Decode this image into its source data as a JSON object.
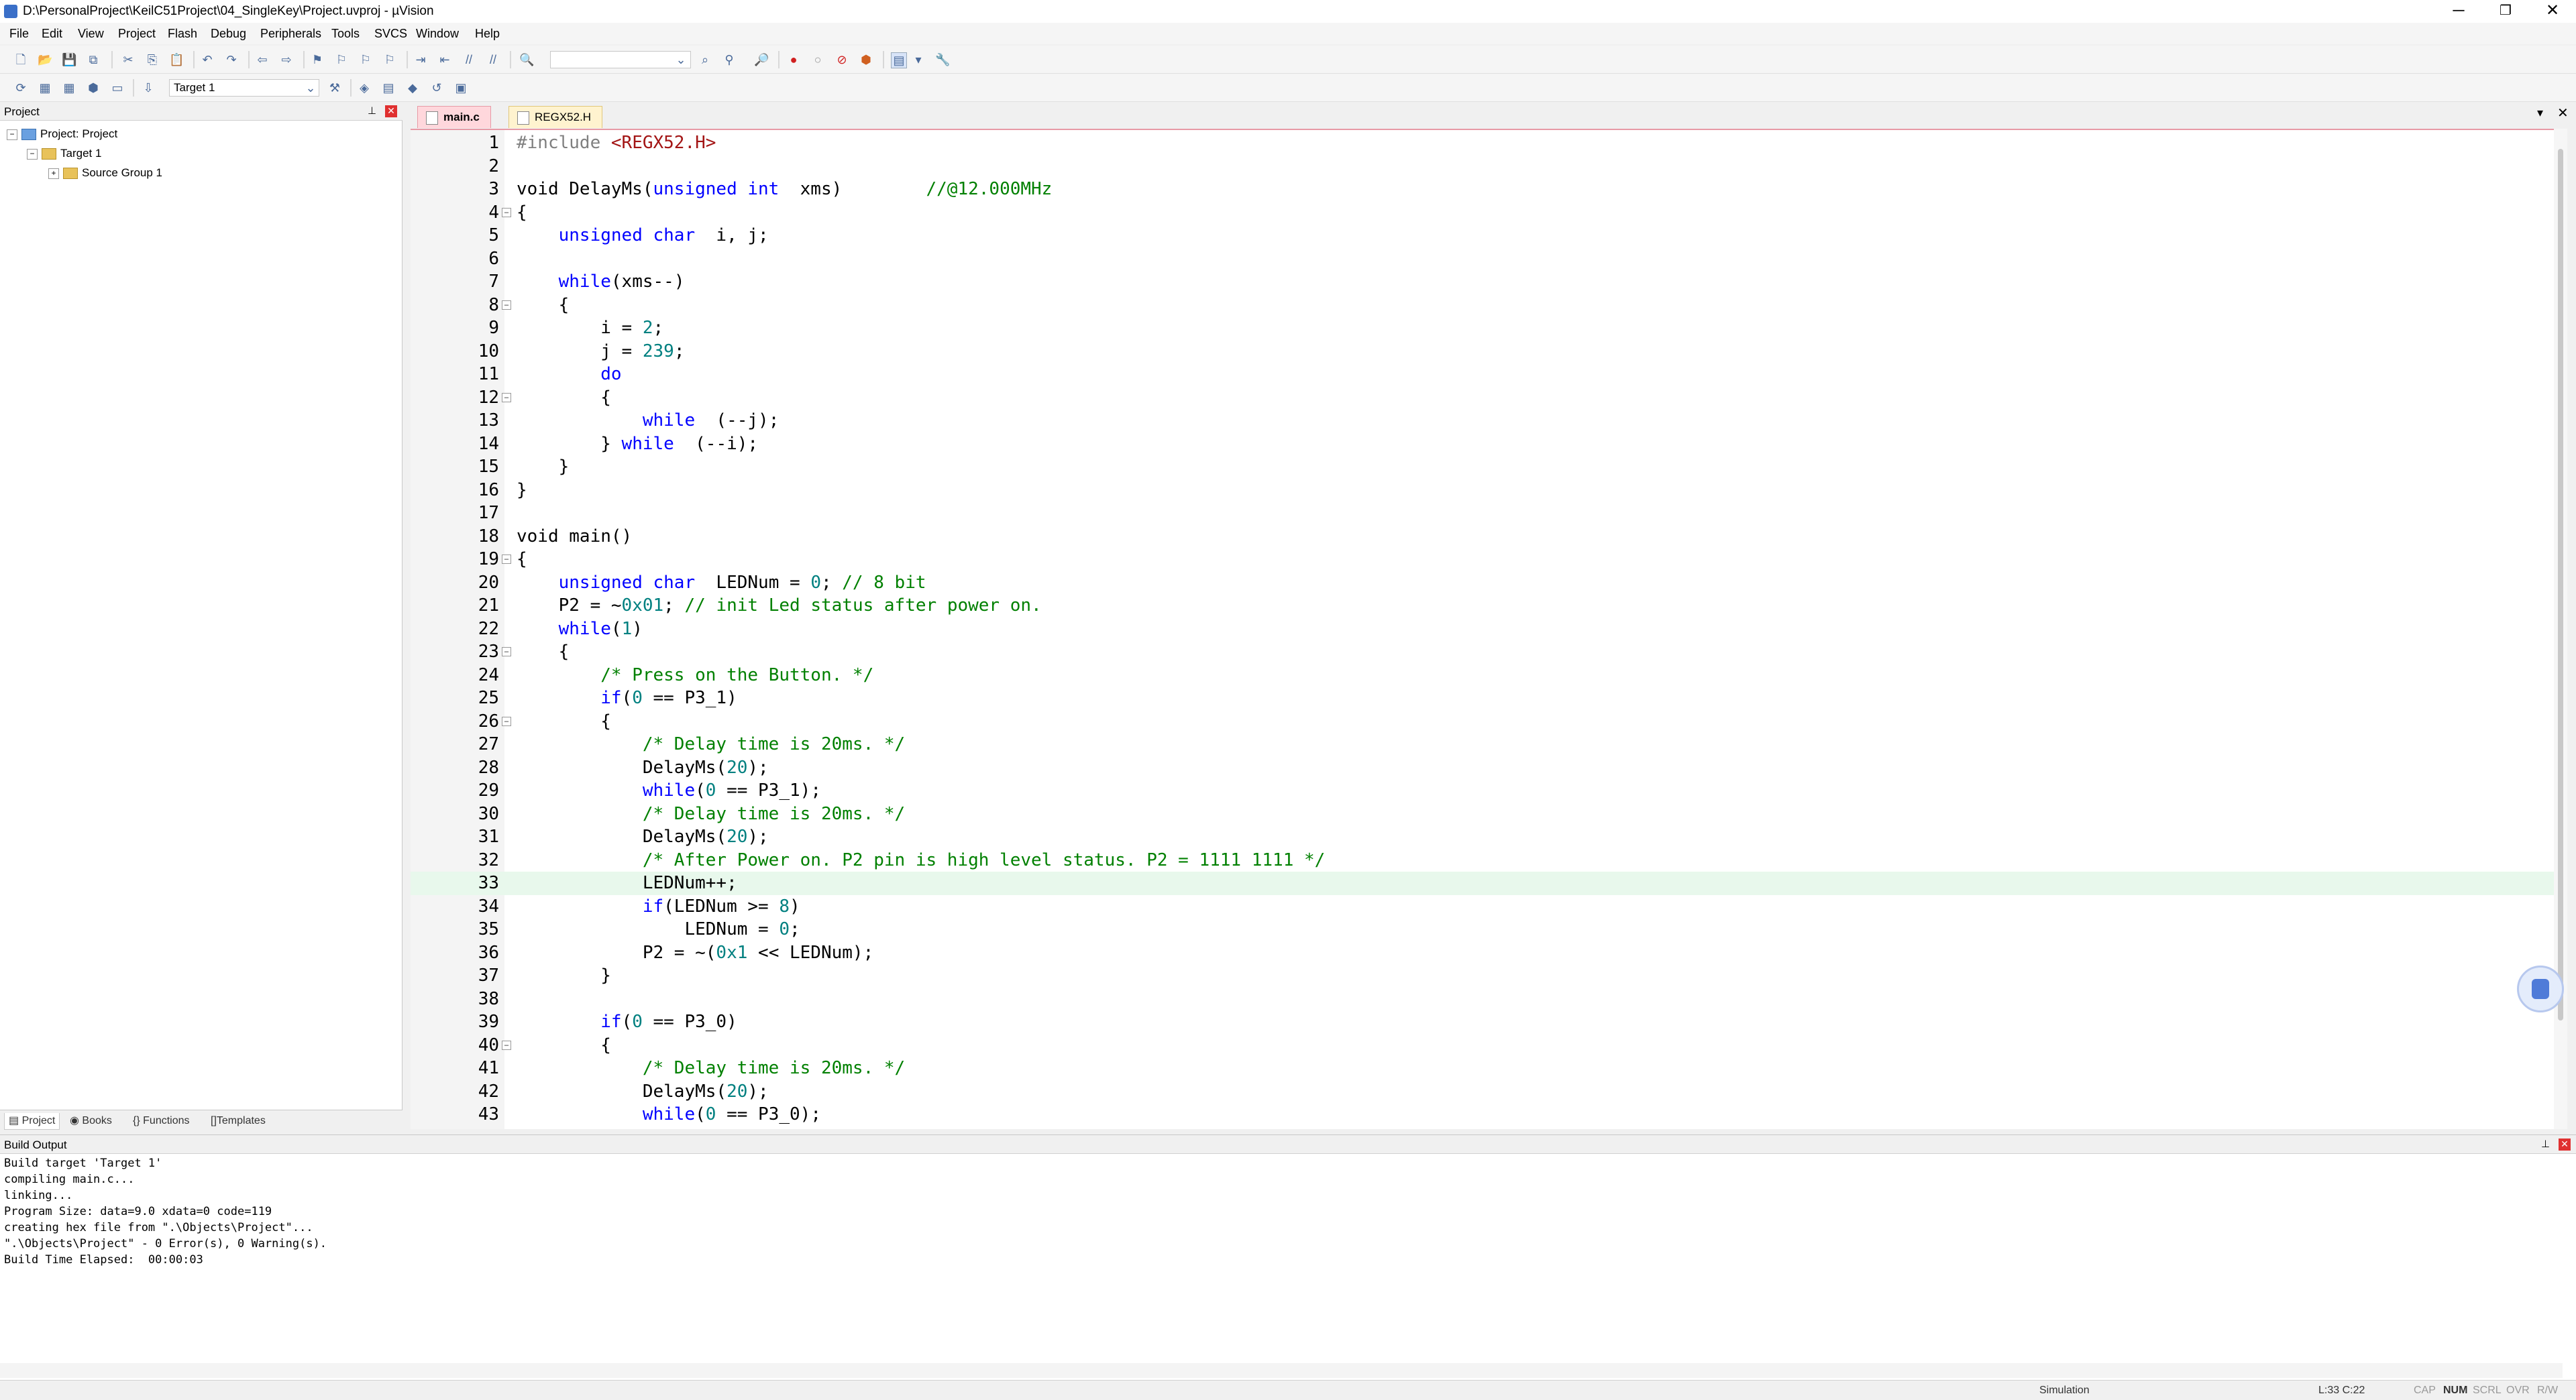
{
  "window": {
    "title": "D:\\PersonalProject\\KeilC51Project\\04_SingleKey\\Project.uvproj - µVision",
    "minimize": "─",
    "maximize": "❐",
    "close": "✕"
  },
  "menu": [
    "File",
    "Edit",
    "View",
    "Project",
    "Flash",
    "Debug",
    "Peripherals",
    "Tools",
    "SVCS",
    "Window",
    "Help"
  ],
  "toolbar2": {
    "target": "Target 1"
  },
  "project_panel": {
    "title": "Project",
    "tree": {
      "root": "Project: Project",
      "target": "Target 1",
      "group": "Source Group 1"
    },
    "tabs": [
      "Project",
      "Books",
      "Functions",
      "Templates"
    ]
  },
  "editor": {
    "tabs": [
      "main.c",
      "REGX52.H"
    ],
    "current_line": 33,
    "lines": [
      {
        "n": "1",
        "fold": "",
        "t": [
          [
            "pp",
            "#include "
          ],
          [
            "st",
            "<REGX52.H>"
          ]
        ]
      },
      {
        "n": "2",
        "fold": "",
        "t": []
      },
      {
        "n": "3",
        "fold": "",
        "t": [
          [
            "",
            "void DelayMs("
          ],
          [
            "kw",
            "unsigned int"
          ],
          [
            "",
            "  xms)        "
          ],
          [
            "cm",
            "//@12.000MHz"
          ]
        ]
      },
      {
        "n": "4",
        "fold": "⊟",
        "t": [
          [
            "",
            "{"
          ]
        ]
      },
      {
        "n": "5",
        "fold": "",
        "t": [
          [
            "",
            "    "
          ],
          [
            "kw",
            "unsigned char"
          ],
          [
            "",
            "  i, j;"
          ]
        ]
      },
      {
        "n": "6",
        "fold": "",
        "t": []
      },
      {
        "n": "7",
        "fold": "",
        "t": [
          [
            "",
            "    "
          ],
          [
            "kw",
            "while"
          ],
          [
            "",
            "(xms--)"
          ]
        ]
      },
      {
        "n": "8",
        "fold": "⊟",
        "t": [
          [
            "",
            "    {"
          ]
        ]
      },
      {
        "n": "9",
        "fold": "",
        "t": [
          [
            "",
            "        i = "
          ],
          [
            "nm",
            "2"
          ],
          [
            "",
            ";"
          ]
        ]
      },
      {
        "n": "10",
        "fold": "",
        "t": [
          [
            "",
            "        j = "
          ],
          [
            "nm",
            "239"
          ],
          [
            "",
            ";"
          ]
        ]
      },
      {
        "n": "11",
        "fold": "",
        "t": [
          [
            "",
            "        "
          ],
          [
            "kw",
            "do"
          ]
        ]
      },
      {
        "n": "12",
        "fold": "⊟",
        "t": [
          [
            "",
            "        {"
          ]
        ]
      },
      {
        "n": "13",
        "fold": "",
        "t": [
          [
            "",
            "            "
          ],
          [
            "kw",
            "while"
          ],
          [
            "",
            "  (--j);"
          ]
        ]
      },
      {
        "n": "14",
        "fold": "",
        "t": [
          [
            "",
            "        } "
          ],
          [
            "kw",
            "while"
          ],
          [
            "",
            "  (--i);"
          ]
        ]
      },
      {
        "n": "15",
        "fold": "",
        "t": [
          [
            "",
            "    }"
          ]
        ]
      },
      {
        "n": "16",
        "fold": "",
        "t": [
          [
            "",
            "}"
          ]
        ]
      },
      {
        "n": "17",
        "fold": "",
        "t": []
      },
      {
        "n": "18",
        "fold": "",
        "t": [
          [
            "",
            "void main()"
          ]
        ]
      },
      {
        "n": "19",
        "fold": "⊟",
        "t": [
          [
            "",
            "{"
          ]
        ]
      },
      {
        "n": "20",
        "fold": "",
        "t": [
          [
            "",
            "    "
          ],
          [
            "kw",
            "unsigned char"
          ],
          [
            "",
            "  LEDNum = "
          ],
          [
            "nm",
            "0"
          ],
          [
            "",
            "; "
          ],
          [
            "cm",
            "// 8 bit"
          ]
        ]
      },
      {
        "n": "21",
        "fold": "",
        "t": [
          [
            "",
            "    P2 = ~"
          ],
          [
            "nm",
            "0x01"
          ],
          [
            "",
            "; "
          ],
          [
            "cm",
            "// init Led status after power on."
          ]
        ]
      },
      {
        "n": "22",
        "fold": "",
        "t": [
          [
            "",
            "    "
          ],
          [
            "kw",
            "while"
          ],
          [
            "",
            "("
          ],
          [
            "nm",
            "1"
          ],
          [
            "",
            ")"
          ]
        ]
      },
      {
        "n": "23",
        "fold": "⊟",
        "t": [
          [
            "",
            "    {"
          ]
        ]
      },
      {
        "n": "24",
        "fold": "",
        "t": [
          [
            "",
            "        "
          ],
          [
            "cm",
            "/* Press on the Button. */"
          ]
        ]
      },
      {
        "n": "25",
        "fold": "",
        "t": [
          [
            "",
            "        "
          ],
          [
            "kw",
            "if"
          ],
          [
            "",
            "("
          ],
          [
            "nm",
            "0"
          ],
          [
            "",
            " == P3_1)"
          ]
        ]
      },
      {
        "n": "26",
        "fold": "⊟",
        "t": [
          [
            "",
            "        {"
          ]
        ]
      },
      {
        "n": "27",
        "fold": "",
        "t": [
          [
            "",
            "            "
          ],
          [
            "cm",
            "/* Delay time is 20ms. */"
          ]
        ]
      },
      {
        "n": "28",
        "fold": "",
        "t": [
          [
            "",
            "            DelayMs("
          ],
          [
            "nm",
            "20"
          ],
          [
            "",
            ");"
          ]
        ]
      },
      {
        "n": "29",
        "fold": "",
        "t": [
          [
            "",
            "            "
          ],
          [
            "kw",
            "while"
          ],
          [
            "",
            "("
          ],
          [
            "nm",
            "0"
          ],
          [
            "",
            " == P3_1);"
          ]
        ]
      },
      {
        "n": "30",
        "fold": "",
        "t": [
          [
            "",
            "            "
          ],
          [
            "cm",
            "/* Delay time is 20ms. */"
          ]
        ]
      },
      {
        "n": "31",
        "fold": "",
        "t": [
          [
            "",
            "            DelayMs("
          ],
          [
            "nm",
            "20"
          ],
          [
            "",
            ");"
          ]
        ]
      },
      {
        "n": "32",
        "fold": "",
        "t": [
          [
            "",
            "            "
          ],
          [
            "cm",
            "/* After Power on. P2 pin is high level status. P2 = 1111 1111 */"
          ]
        ]
      },
      {
        "n": "33",
        "fold": "",
        "t": [
          [
            "",
            "            LEDNum++;"
          ]
        ]
      },
      {
        "n": "34",
        "fold": "",
        "t": [
          [
            "",
            "            "
          ],
          [
            "kw",
            "if"
          ],
          [
            "",
            "(LEDNum >= "
          ],
          [
            "nm",
            "8"
          ],
          [
            "",
            ")"
          ]
        ]
      },
      {
        "n": "35",
        "fold": "",
        "t": [
          [
            "",
            "                LEDNum = "
          ],
          [
            "nm",
            "0"
          ],
          [
            "",
            ";"
          ]
        ]
      },
      {
        "n": "36",
        "fold": "",
        "t": [
          [
            "",
            "            P2 = ~("
          ],
          [
            "nm",
            "0x1"
          ],
          [
            "",
            " << LEDNum);"
          ]
        ]
      },
      {
        "n": "37",
        "fold": "",
        "t": [
          [
            "",
            "        }"
          ]
        ]
      },
      {
        "n": "38",
        "fold": "",
        "t": []
      },
      {
        "n": "39",
        "fold": "",
        "t": [
          [
            "",
            "        "
          ],
          [
            "kw",
            "if"
          ],
          [
            "",
            "("
          ],
          [
            "nm",
            "0"
          ],
          [
            "",
            " == P3_0)"
          ]
        ]
      },
      {
        "n": "40",
        "fold": "⊟",
        "t": [
          [
            "",
            "        {"
          ]
        ]
      },
      {
        "n": "41",
        "fold": "",
        "t": [
          [
            "",
            "            "
          ],
          [
            "cm",
            "/* Delay time is 20ms. */"
          ]
        ]
      },
      {
        "n": "42",
        "fold": "",
        "t": [
          [
            "",
            "            DelayMs("
          ],
          [
            "nm",
            "20"
          ],
          [
            "",
            ");"
          ]
        ]
      },
      {
        "n": "43",
        "fold": "",
        "t": [
          [
            "",
            "            "
          ],
          [
            "kw",
            "while"
          ],
          [
            "",
            "("
          ],
          [
            "nm",
            "0"
          ],
          [
            "",
            " == P3_0);"
          ]
        ]
      }
    ]
  },
  "build_output": {
    "title": "Build Output",
    "lines": [
      "Build target 'Target 1'",
      "compiling main.c...",
      "linking...",
      "Program Size: data=9.0 xdata=0 code=119",
      "creating hex file from \".\\Objects\\Project\"...",
      "\".\\Objects\\Project\" - 0 Error(s), 0 Warning(s).",
      "Build Time Elapsed:  00:00:03"
    ]
  },
  "status": {
    "mode": "Simulation",
    "position": "L:33 C:22",
    "flags": [
      "CAP",
      "NUM",
      "SCRL",
      "OVR",
      "R/W"
    ]
  }
}
